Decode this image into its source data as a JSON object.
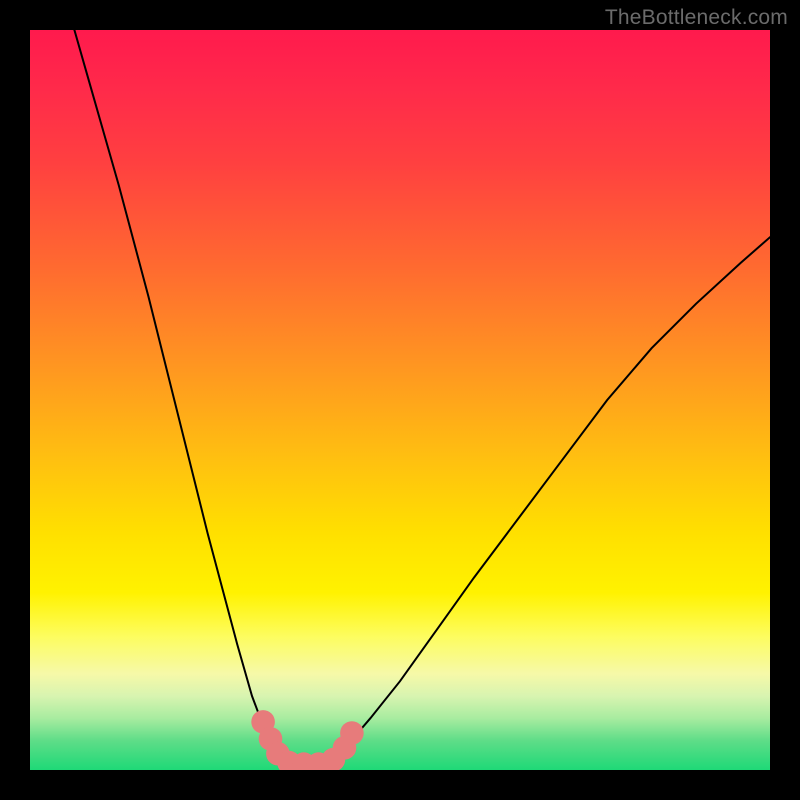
{
  "watermark": "TheBottleneck.com",
  "chart_data": {
    "type": "line",
    "title": "",
    "xlabel": "",
    "ylabel": "",
    "xlim": [
      0,
      100
    ],
    "ylim": [
      0,
      100
    ],
    "grid": false,
    "series": [
      {
        "name": "left-branch",
        "x": [
          6,
          8,
          10,
          12,
          14,
          16,
          18,
          20,
          22,
          24,
          26,
          28,
          30,
          31.5,
          33,
          34.5
        ],
        "y": [
          100,
          93,
          86,
          79,
          71.5,
          64,
          56,
          48,
          40,
          32,
          24.5,
          17,
          10,
          6,
          3,
          1.2
        ]
      },
      {
        "name": "right-branch",
        "x": [
          41,
          43,
          46,
          50,
          55,
          60,
          66,
          72,
          78,
          84,
          90,
          96,
          100
        ],
        "y": [
          1.2,
          3.5,
          7,
          12,
          19,
          26,
          34,
          42,
          50,
          57,
          63,
          68.5,
          72
        ]
      },
      {
        "name": "valley-floor",
        "x": [
          34.5,
          36,
          38,
          40,
          41
        ],
        "y": [
          1.2,
          0.8,
          0.8,
          0.8,
          1.2
        ]
      }
    ],
    "markers": {
      "name": "valley-highlight",
      "color": "#e77b7b",
      "points": [
        {
          "x": 31.5,
          "y": 6.5,
          "r": 1.6
        },
        {
          "x": 32.5,
          "y": 4.2,
          "r": 1.6
        },
        {
          "x": 33.5,
          "y": 2.2,
          "r": 1.6
        },
        {
          "x": 35.0,
          "y": 1.0,
          "r": 1.6
        },
        {
          "x": 37.0,
          "y": 0.8,
          "r": 1.6
        },
        {
          "x": 39.0,
          "y": 0.8,
          "r": 1.6
        },
        {
          "x": 41.0,
          "y": 1.4,
          "r": 1.6
        },
        {
          "x": 42.5,
          "y": 3.0,
          "r": 1.6
        },
        {
          "x": 43.5,
          "y": 5.0,
          "r": 1.6
        }
      ]
    },
    "background_gradient": {
      "top": "#ff1a4d",
      "mid": "#ffe000",
      "bottom": "#1ed977"
    }
  }
}
